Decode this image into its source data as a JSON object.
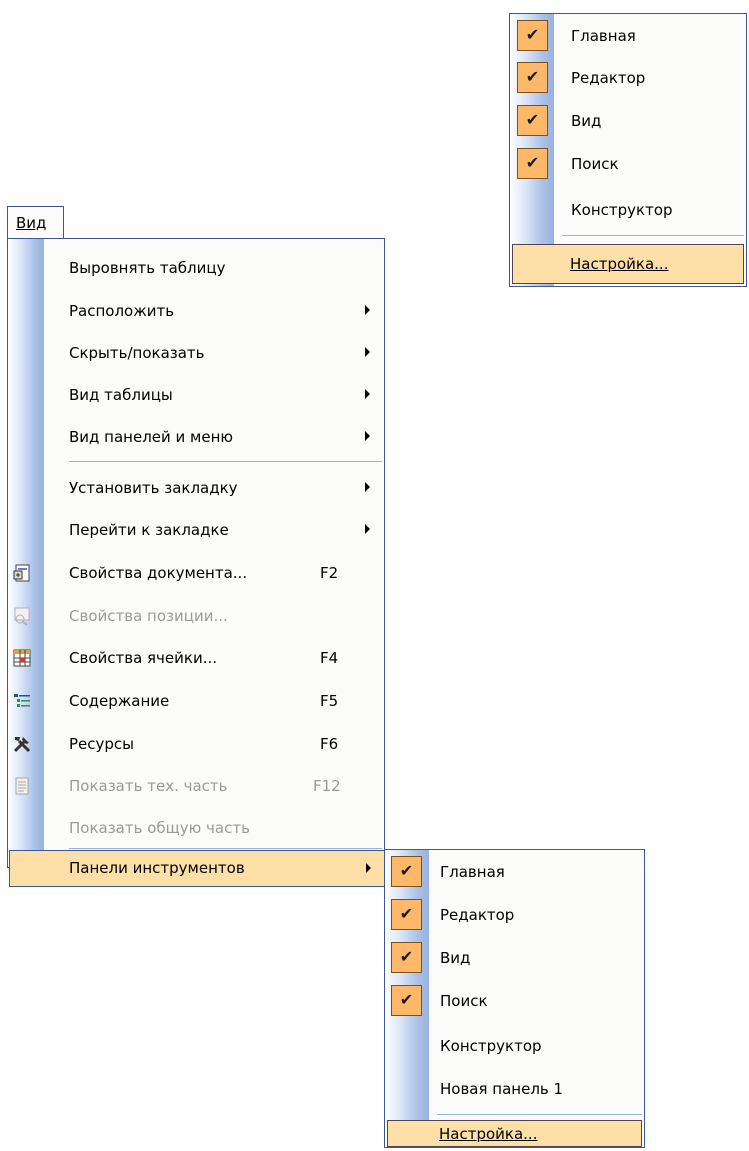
{
  "menubar": {
    "view_label": "Вид"
  },
  "view_menu": {
    "items": [
      {
        "label": "Выровнять таблицу"
      },
      {
        "label": "Расположить"
      },
      {
        "label": "Скрыть/показать"
      },
      {
        "label": "Вид таблицы"
      },
      {
        "label": "Вид панелей и меню"
      },
      {
        "label": "Установить закладку"
      },
      {
        "label": "Перейти к закладке"
      },
      {
        "label": "Свойства документа...",
        "shortcut": "F2"
      },
      {
        "label": "Свойства позиции...",
        "disabled": true
      },
      {
        "label": "Свойства ячейки...",
        "shortcut": "F4"
      },
      {
        "label": "Содержание",
        "shortcut": "F5"
      },
      {
        "label": "Ресурсы",
        "shortcut": "F6"
      },
      {
        "label": "Показать тех. часть",
        "shortcut": "F12",
        "disabled": true
      },
      {
        "label": "Показать общую часть",
        "disabled": true
      },
      {
        "label": "Панели инструментов",
        "highlighted": true
      }
    ]
  },
  "toolbars_popup_top": {
    "items": [
      {
        "label": "Главная",
        "checked": true
      },
      {
        "label": "Редактор",
        "checked": true
      },
      {
        "label": "Вид",
        "checked": true
      },
      {
        "label": "Поиск",
        "checked": true
      },
      {
        "label": "Конструктор",
        "checked": false
      }
    ],
    "settings_label": "Настройка..."
  },
  "toolbars_submenu": {
    "items": [
      {
        "label": "Главная",
        "checked": true
      },
      {
        "label": "Редактор",
        "checked": true
      },
      {
        "label": "Вид",
        "checked": true
      },
      {
        "label": "Поиск",
        "checked": true
      },
      {
        "label": "Конструктор",
        "checked": false
      },
      {
        "label": "Новая панель 1",
        "checked": false
      }
    ],
    "settings_label": "Настройка..."
  },
  "icons": {
    "check": "✔",
    "doc_props": "properties-icon",
    "pos_props": "position-properties-icon",
    "cell_props": "cell-properties-icon",
    "contents": "contents-icon",
    "resources": "tools-icon",
    "tech_part": "document-icon"
  },
  "colors": {
    "border": "#3d5694",
    "highlight": "#fedfa8",
    "check_bg": "#fdb86a"
  }
}
